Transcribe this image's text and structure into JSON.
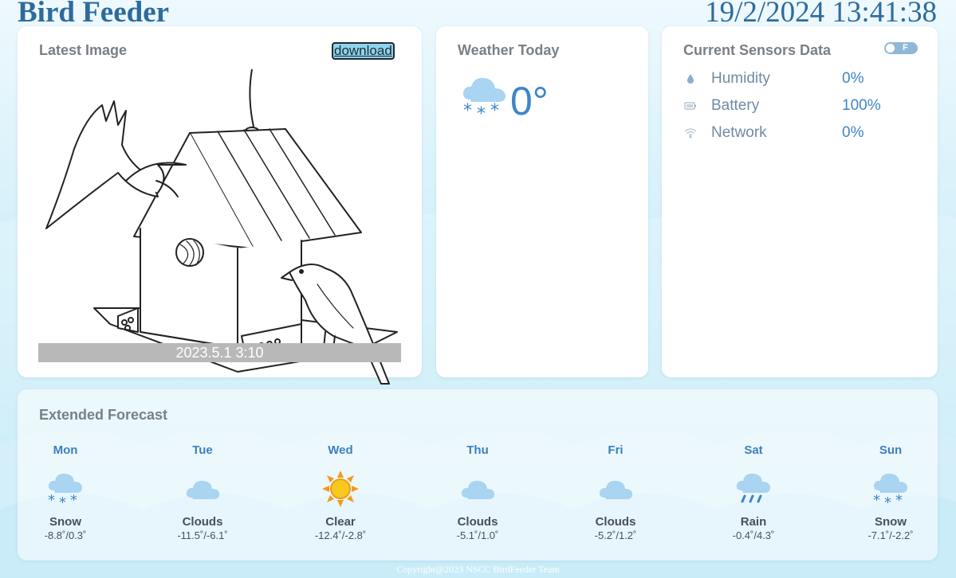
{
  "app": {
    "title": "Bird Feeder",
    "datetime": "19/2/2024 13:41:38"
  },
  "latest_image": {
    "title": "Latest Image",
    "download_label": "download",
    "caption": "2023.5.1 3:10"
  },
  "weather_today": {
    "title": "Weather Today",
    "temperature": "0°",
    "icon": "snow-icon"
  },
  "sensors": {
    "title": "Current Sensors Data",
    "unit_toggle": "F",
    "items": [
      {
        "label": "Humidity",
        "value": "0%",
        "icon": "droplet-icon"
      },
      {
        "label": "Battery",
        "value": "100%",
        "icon": "battery-icon"
      },
      {
        "label": "Network",
        "value": "0%",
        "icon": "wifi-icon"
      }
    ]
  },
  "forecast": {
    "title": "Extended Forecast",
    "days": [
      {
        "day": "Mon",
        "condition": "Snow",
        "temps": "-8.8˚/0.3˚",
        "icon": "snow-icon"
      },
      {
        "day": "Tue",
        "condition": "Clouds",
        "temps": "-11.5˚/-6.1˚",
        "icon": "cloud-icon"
      },
      {
        "day": "Wed",
        "condition": "Clear",
        "temps": "-12.4˚/-2.8˚",
        "icon": "sun-icon"
      },
      {
        "day": "Thu",
        "condition": "Clouds",
        "temps": "-5.1˚/1.0˚",
        "icon": "cloud-icon"
      },
      {
        "day": "Fri",
        "condition": "Clouds",
        "temps": "-5.2˚/1.2˚",
        "icon": "cloud-icon"
      },
      {
        "day": "Sat",
        "condition": "Rain",
        "temps": "-0.4˚/4.3˚",
        "icon": "rain-icon"
      },
      {
        "day": "Sun",
        "condition": "Snow",
        "temps": "-7.1˚/-2.2˚",
        "icon": "snow-icon"
      }
    ]
  },
  "footer": {
    "copyright": "Copyright@2023 NSCC BirdFeeder Team"
  },
  "colors": {
    "accent": "#3c86c8",
    "title": "#2d6b9c",
    "card": "#ffffff",
    "sky": "#bfe8f6"
  }
}
